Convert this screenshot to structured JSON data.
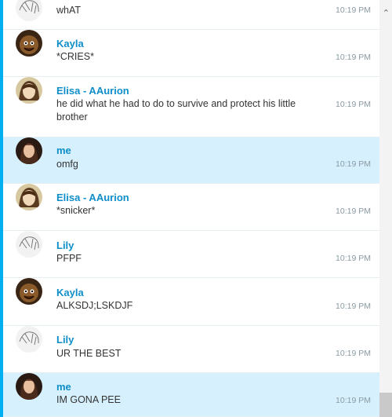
{
  "messages": [
    {
      "sender": "",
      "text": "whAT",
      "time": "10:19 PM",
      "self": false,
      "avatar": "lily-avatar"
    },
    {
      "sender": "Kayla",
      "text": "*CRIES*",
      "time": "10:19 PM",
      "self": false,
      "avatar": "kayla-avatar"
    },
    {
      "sender": "Elisa - AAurion",
      "text": "he did what he had to do to survive and protect his little brother",
      "time": "10:19 PM",
      "self": false,
      "avatar": "elisa-avatar"
    },
    {
      "sender": "me",
      "text": "omfg",
      "time": "10:19 PM",
      "self": true,
      "avatar": "me-avatar"
    },
    {
      "sender": "Elisa - AAurion",
      "text": "*snicker*",
      "time": "10:19 PM",
      "self": false,
      "avatar": "elisa-avatar"
    },
    {
      "sender": "Lily",
      "text": "PFPF",
      "time": "10:19 PM",
      "self": false,
      "avatar": "lily-avatar"
    },
    {
      "sender": "Kayla",
      "text": "ALKSDJ;LSKDJF",
      "time": "10:19 PM",
      "self": false,
      "avatar": "kayla-avatar"
    },
    {
      "sender": "Lily",
      "text": "UR THE BEST",
      "time": "10:19 PM",
      "self": false,
      "avatar": "lily-avatar"
    },
    {
      "sender": "me",
      "text": "IM GONA PEE",
      "time": "10:19 PM",
      "self": true,
      "avatar": "me-avatar"
    }
  ],
  "colors": {
    "accent": "#00aff0",
    "sender": "#0e8ec9",
    "self_bg": "#d6f1fd"
  }
}
